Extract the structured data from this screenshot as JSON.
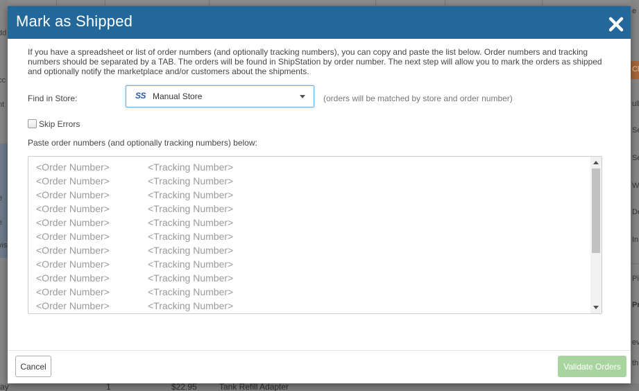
{
  "background": {
    "left_fragments": [
      "dd",
      "cc",
      "nt",
      "e",
      "e",
      "vis",
      "t",
      "ray"
    ],
    "right_fragments": [
      "e",
      "Cl",
      "ull",
      "Se",
      "Se",
      "W",
      "De",
      "In",
      "Pi",
      "Pr",
      "ev",
      "th"
    ],
    "bottom_fragments": {
      "qty": "1",
      "price": "$22.95",
      "item": "Tank Refill Adapter"
    }
  },
  "modal": {
    "title": "Mark as Shipped",
    "close_icon": "close-icon",
    "intro": "If you have a spreadsheet or list of order numbers (and optionally tracking numbers), you can copy and paste the list below. Order numbers and tracking numbers should be separated by a TAB. The orders will be found in ShipStation by order number. The next step will allow you to mark the orders as shipped and optionally notify the marketplace and/or customers about the shipments.",
    "find_in_store_label": "Find in Store:",
    "store_icon_text": "SS",
    "store_value": "Manual Store",
    "store_hint": "(orders will be matched by store and order number)",
    "skip_errors_label": "Skip Errors",
    "skip_errors_checked": false,
    "paste_label": "Paste order numbers (and optionally tracking numbers) below:",
    "paste_rows": [
      {
        "order": "<Order Number>",
        "tracking": "<Tracking Number>"
      },
      {
        "order": "<Order Number>",
        "tracking": "<Tracking Number>"
      },
      {
        "order": "<Order Number>",
        "tracking": "<Tracking Number>"
      },
      {
        "order": "<Order Number>",
        "tracking": "<Tracking Number>"
      },
      {
        "order": "<Order Number>",
        "tracking": "<Tracking Number>"
      },
      {
        "order": "<Order Number>",
        "tracking": "<Tracking Number>"
      },
      {
        "order": "<Order Number>",
        "tracking": "<Tracking Number>"
      },
      {
        "order": "<Order Number>",
        "tracking": "<Tracking Number>"
      },
      {
        "order": "<Order Number>",
        "tracking": "<Tracking Number>"
      },
      {
        "order": "<Order Number>",
        "tracking": "<Tracking Number>"
      },
      {
        "order": "<Order Number>",
        "tracking": "<Tracking Number>"
      }
    ],
    "cancel_label": "Cancel",
    "validate_label": "Validate Orders"
  },
  "colors": {
    "header": "#23689a",
    "validate_button": "#a8d59f",
    "select_focus": "#66afe9"
  }
}
